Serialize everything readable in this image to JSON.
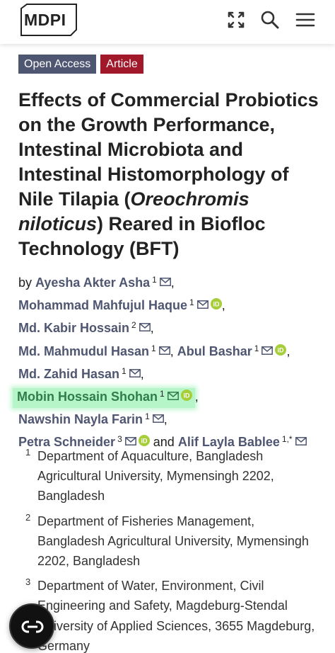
{
  "header": {
    "logo_text": "MDPI",
    "icons": [
      "expand-icon",
      "search-icon",
      "menu-icon"
    ]
  },
  "badges": {
    "open_access": "Open Access",
    "article": "Article"
  },
  "title": {
    "part1": "Effects of Commercial Probiotics on the Growth Performance, Intestinal Microbiota and Intestinal Histomorphology of Nile Tilapia (",
    "italic": "Oreochromis niloticus",
    "part2": ") Reared in Biofloc Technology (BFT)"
  },
  "authors": {
    "by": "by",
    "and": "and",
    "list": [
      {
        "name": "Ayesha Akter Asha",
        "sup": "1"
      },
      {
        "name": "Mohammad Mahfujul Haque",
        "sup": "1"
      },
      {
        "name": "Md. Kabir Hossain",
        "sup": "2"
      },
      {
        "name": "Md. Mahmudul Hasan",
        "sup": "1"
      },
      {
        "name": "Abul Bashar",
        "sup": "1"
      },
      {
        "name": "Md. Zahid Hasan",
        "sup": "1"
      },
      {
        "name": "Mobin Hossain Shohan",
        "sup": "1"
      },
      {
        "name": "Nawshin Nayla Farin",
        "sup": "1"
      },
      {
        "name": "Petra Schneider",
        "sup": "3"
      },
      {
        "name": "Alif Layla Bablee",
        "sup": "1,*"
      }
    ]
  },
  "affiliations": [
    {
      "num": "1",
      "text": "Department of Aquaculture, Bangladesh Agricultural University, Mymensingh 2202, Bangladesh"
    },
    {
      "num": "2",
      "text": "Department of Fisheries Management, Bangladesh Agricultural University, Mymensingh 2202, Bangladesh"
    },
    {
      "num": "3",
      "text": "Department of Water, Environment, Civil Engineering and Safety, Magdeburg-Stendal University of Applied Sciences, 3655 Magdeburg, Germany"
    }
  ],
  "colors": {
    "author_link": "#4f5671",
    "open_access_bg": "#4f5671",
    "article_bg": "#a2182b",
    "orcid": "#a6ce39",
    "highlight": "#b6f5c8"
  }
}
